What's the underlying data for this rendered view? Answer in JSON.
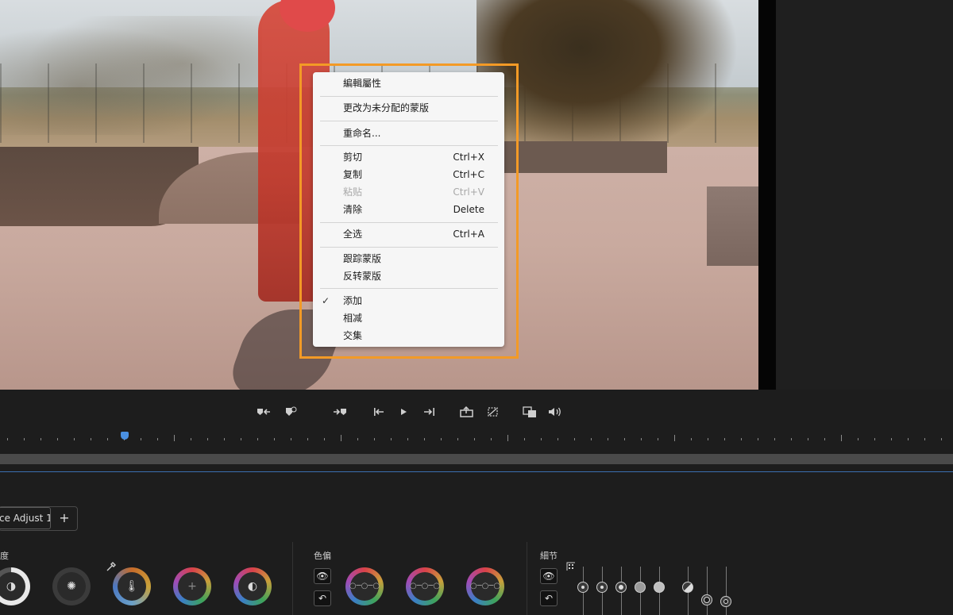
{
  "context_menu": {
    "items": {
      "edit_props": {
        "label": "編輯屬性"
      },
      "unassign": {
        "label": "更改为未分配的蒙版"
      },
      "rename": {
        "label": "重命名..."
      },
      "cut": {
        "label": "剪切",
        "shortcut": "Ctrl+X"
      },
      "copy": {
        "label": "复制",
        "shortcut": "Ctrl+C"
      },
      "paste": {
        "label": "粘贴",
        "shortcut": "Ctrl+V"
      },
      "clear": {
        "label": "清除",
        "shortcut": "Delete"
      },
      "select_all": {
        "label": "全选",
        "shortcut": "Ctrl+A"
      },
      "track_mask": {
        "label": "跟踪蒙版"
      },
      "invert_mask": {
        "label": "反转蒙版"
      },
      "add": {
        "label": "添加",
        "check": "✓"
      },
      "subtract": {
        "label": "相减"
      },
      "intersect": {
        "label": "交集"
      }
    },
    "highlight_color": "#f39a26"
  },
  "transport": {
    "icons": [
      "mark-in-icon",
      "mark-out-icon",
      "go-to-in-icon",
      "step-back-icon",
      "play-icon",
      "step-forward-icon",
      "export-frame-icon",
      "safe-margins-icon",
      "compare-icon",
      "volume-icon"
    ]
  },
  "bottom": {
    "tab_label": "ce Adjust 1",
    "add_tab": "+",
    "section_brightness": "度",
    "section_color": "色偏",
    "section_detail": "細节"
  },
  "colors": {
    "playhead": "#4a90e2",
    "timeline_line": "#3b6fb0"
  }
}
